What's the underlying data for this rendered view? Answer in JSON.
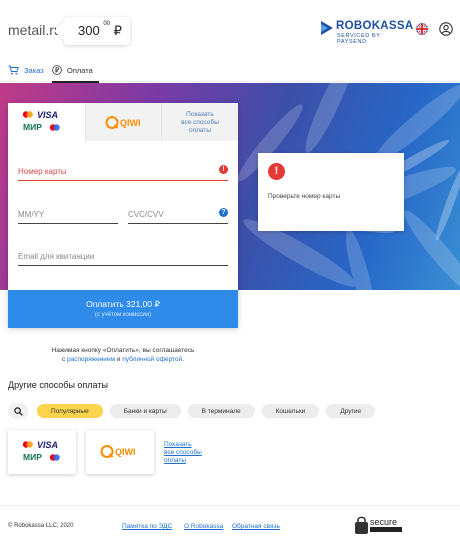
{
  "header": {
    "site": "metail.ru",
    "amount_main": "300",
    "amount_cents": "00",
    "currency": "₽",
    "brand": "ROBOKASSA",
    "brand_sub": "SERVICED BY PAYSEND"
  },
  "tabs": [
    {
      "label": "Заказ",
      "icon": "cart-icon"
    },
    {
      "label": "Оплата",
      "icon": "ruble-circle-icon"
    }
  ],
  "payment_tabs": [
    {
      "label": "VISA / МИР",
      "icon": "card-brands-icon"
    },
    {
      "label": "QIWI",
      "icon": "qiwi-icon"
    },
    {
      "label": "Показать все способы оплаты"
    }
  ],
  "form": {
    "card_number_placeholder": "Номер карты",
    "expiry_placeholder": "MM/YY",
    "cvc_placeholder": "CVC/CVV",
    "email_placeholder": "Email для квитанции"
  },
  "pay_button": {
    "label": "Оплатить 321,00 ₽",
    "sublabel": "(с учётом комиссии)"
  },
  "alert": {
    "text": "Проверьте номер карты"
  },
  "consent": {
    "prefix": "Нажимая кнопку «Оплатить», вы соглашаетесь",
    "with": "с",
    "link1": "распоряжением",
    "and": "и",
    "link2": "публичной офертой",
    "end": "."
  },
  "other": {
    "title": "Другие способы оплаты",
    "chips": [
      "Популярные",
      "Банки и карты",
      "В терминале",
      "Кошельки",
      "Другие"
    ],
    "show_all": [
      "Показать",
      "все способы",
      "оплаты"
    ]
  },
  "footer": {
    "copyright": "© Robokassa LLC, 2020",
    "links": [
      "Памятка по ЭДС",
      "О Robokassa",
      "Обратная связь"
    ],
    "badge": "secure"
  },
  "colors": {
    "accent": "#2f8bea",
    "error": "#e53935",
    "brand": "#1e4fa3",
    "chip_active": "#fcd34d"
  }
}
